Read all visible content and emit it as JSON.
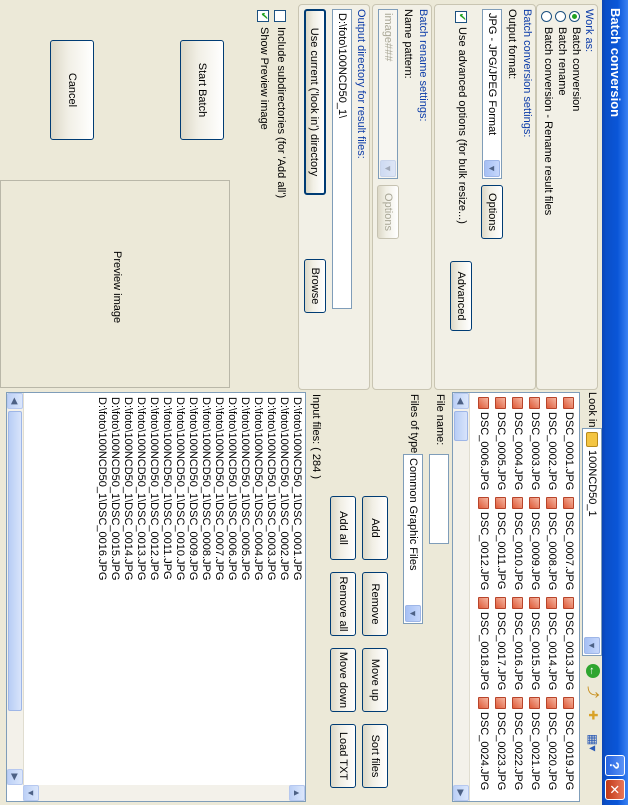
{
  "window": {
    "title": "Batch conversion",
    "help_label": "?",
    "close_label": "✕"
  },
  "work_as": {
    "title": "Work as:",
    "options": [
      {
        "label": "Batch conversion",
        "selected": true
      },
      {
        "label": "Batch rename",
        "selected": false
      },
      {
        "label": "Batch conversion - Rename result files",
        "selected": false
      }
    ]
  },
  "conversion_settings": {
    "title": "Batch conversion settings:",
    "output_format_label": "Output format:",
    "output_format_value": "JPG - JPG/JPEG Format",
    "options_button": "Options",
    "advanced_checkbox": "Use advanced options (for bulk resize...)",
    "advanced_checked": true,
    "advanced_button": "Advanced"
  },
  "rename_settings": {
    "title": "Batch rename settings:",
    "name_pattern_label": "Name pattern:",
    "name_pattern_value": "image###",
    "options_button": "Options"
  },
  "output_dir": {
    "title": "Output directory for result files:",
    "path": "D:\\foto\\100NCD50_1\\",
    "use_current_button": "Use current ('look in') directory",
    "browse_button": "Browse"
  },
  "include_subdirs": {
    "label": "Include subdirectories (for 'Add all')",
    "checked": false
  },
  "show_preview": {
    "label": "Show Preview image",
    "checked": true
  },
  "start_button": "Start Batch",
  "cancel_button": "Cancel",
  "preview_label": "Preview image",
  "look_in": {
    "label": "Look in:",
    "value": "100NCD50_1"
  },
  "file_columns": [
    [
      "DSC_0001.JPG",
      "DSC_0002.JPG",
      "DSC_0003.JPG",
      "DSC_0004.JPG",
      "DSC_0005.JPG",
      "DSC_0006.JPG"
    ],
    [
      "DSC_0007.JPG",
      "DSC_0008.JPG",
      "DSC_0009.JPG",
      "DSC_0010.JPG",
      "DSC_0011.JPG",
      "DSC_0012.JPG"
    ],
    [
      "DSC_0013.JPG",
      "DSC_0014.JPG",
      "DSC_0015.JPG",
      "DSC_0016.JPG",
      "DSC_0017.JPG",
      "DSC_0018.JPG"
    ],
    [
      "DSC_0019.JPG",
      "DSC_0020.JPG",
      "DSC_0021.JPG",
      "DSC_0022.JPG",
      "DSC_0023.JPG",
      "DSC_0024.JPG"
    ]
  ],
  "file_name_label": "File name:",
  "files_of_type": {
    "label": "Files of type:",
    "value": "Common Graphic Files"
  },
  "list_buttons": {
    "add": "Add",
    "remove": "Remove",
    "move_up": "Move up",
    "sort_files": "Sort files",
    "add_all": "Add all",
    "remove_all": "Remove all",
    "move_down": "Move down",
    "load_txt": "Load TXT"
  },
  "input_files": {
    "label": "Input files: ( 284 )",
    "items": [
      "D:\\foto\\100NCD50_1\\DSC_0001.JPG",
      "D:\\foto\\100NCD50_1\\DSC_0002.JPG",
      "D:\\foto\\100NCD50_1\\DSC_0003.JPG",
      "D:\\foto\\100NCD50_1\\DSC_0004.JPG",
      "D:\\foto\\100NCD50_1\\DSC_0005.JPG",
      "D:\\foto\\100NCD50_1\\DSC_0006.JPG",
      "D:\\foto\\100NCD50_1\\DSC_0007.JPG",
      "D:\\foto\\100NCD50_1\\DSC_0008.JPG",
      "D:\\foto\\100NCD50_1\\DSC_0009.JPG",
      "D:\\foto\\100NCD50_1\\DSC_0010.JPG",
      "D:\\foto\\100NCD50_1\\DSC_0011.JPG",
      "D:\\foto\\100NCD50_1\\DSC_0012.JPG",
      "D:\\foto\\100NCD50_1\\DSC_0013.JPG",
      "D:\\foto\\100NCD50_1\\DSC_0014.JPG",
      "D:\\foto\\100NCD50_1\\DSC_0015.JPG",
      "D:\\foto\\100NCD50_1\\DSC_0016.JPG"
    ]
  }
}
